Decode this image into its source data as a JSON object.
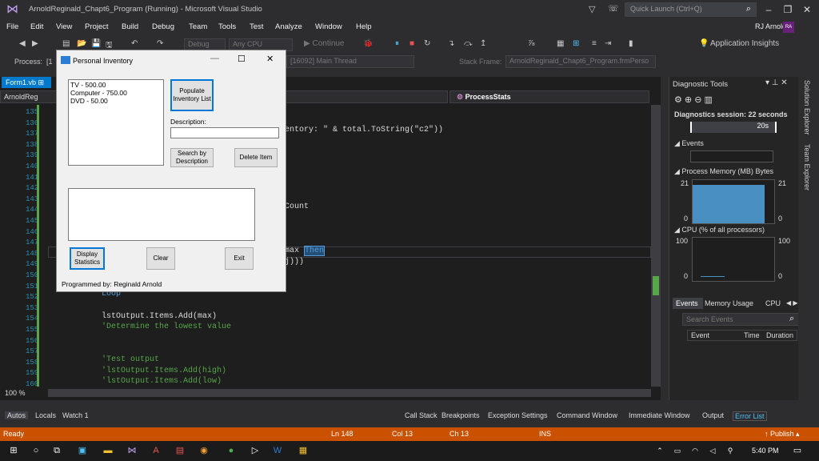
{
  "window": {
    "title": "ArnoldReginald_Chapt6_Program (Running) - Microsoft Visual Studio",
    "quick_launch": "Quick Launch (Ctrl+Q)",
    "user": "RJ Arnold",
    "avatar": "RA"
  },
  "menu": [
    "File",
    "Edit",
    "View",
    "Project",
    "Build",
    "Debug",
    "Team",
    "Tools",
    "Test",
    "Analyze",
    "Window",
    "Help"
  ],
  "toolbar": {
    "config": "Debug",
    "platform": "Any CPU",
    "continue": "Continue",
    "app_insights": "Application Insights"
  },
  "toolbar2": {
    "process_label": "Process:",
    "process_value": "[1",
    "thread": "[16092] Main Thread",
    "stack_label": "Stack Frame:",
    "stack_value": "ArnoldReginald_Chapt6_Program.frmPerso"
  },
  "editor": {
    "tab": "Form1.vb",
    "nav_left": "ArnoldReg",
    "nav_right": "ProcessStats",
    "zoom": "100 %",
    "lines": [
      "135",
      "136",
      "137",
      "138",
      "139",
      "140",
      "141",
      "142",
      "143",
      "144",
      "145",
      "146",
      "147",
      "148",
      "149",
      "150",
      "151",
      "152",
      "153",
      "154",
      "155",
      "156",
      "157",
      "158",
      "159",
      "160"
    ],
    "code": {
      "l137": "entory: \" & total.ToString(\"c2\"))",
      "l144": "Count",
      "l148a": "max ",
      "l148b": "Then",
      "l149": "j)))",
      "l152": "Loop",
      "l154": "lstOutput.Items.Add(max)",
      "l155": "'Determine the lowest value",
      "l158": "'Test output",
      "l159": "'lstOutput.Items.Add(high)",
      "l160": "'lstOutput.Items.Add(low)"
    }
  },
  "diagnostics": {
    "title": "Diagnostic Tools",
    "session": "Diagnostics session: 22 seconds",
    "time_marker": "20s",
    "events_label": "Events",
    "memory_label": "Process Memory (MB)",
    "memory_unit": "Bytes",
    "memory_max": "21",
    "memory_min": "0",
    "cpu_label": "CPU (% of all processors)",
    "cpu_max": "100",
    "cpu_min": "0",
    "tabs": [
      "Events",
      "Memory Usage",
      "CPU"
    ],
    "search": "Search Events",
    "cols": [
      "Event",
      "Time",
      "Duration"
    ]
  },
  "side_tabs": [
    "Solution Explorer",
    "Team Explorer"
  ],
  "bottom_tabs_left": [
    "Autos",
    "Locals",
    "Watch 1"
  ],
  "bottom_tabs_right": [
    "Call Stack",
    "Breakpoints",
    "Exception Settings",
    "Command Window",
    "Immediate Window",
    "Output",
    "Error List"
  ],
  "status": {
    "ready": "Ready",
    "ln": "Ln 148",
    "col": "Col 13",
    "ch": "Ch 13",
    "ins": "INS",
    "publish": "Publish"
  },
  "taskbar": {
    "time": "5:40 PM"
  },
  "form": {
    "title": "Personal Inventory",
    "list_items": [
      "TV - 500.00",
      "Computer - 750.00",
      "DVD - 50.00"
    ],
    "populate": "Populate Inventory List",
    "description_label": "Description:",
    "search": "Search by Description",
    "delete": "Delete Item",
    "display": "Display Statistics",
    "clear": "Clear",
    "exit": "Exit",
    "footer": "Programmed by: Reginald Arnold"
  },
  "colors": {
    "accent": "#007acc",
    "status": "#ca5100",
    "vs_purple": "#68217a"
  }
}
